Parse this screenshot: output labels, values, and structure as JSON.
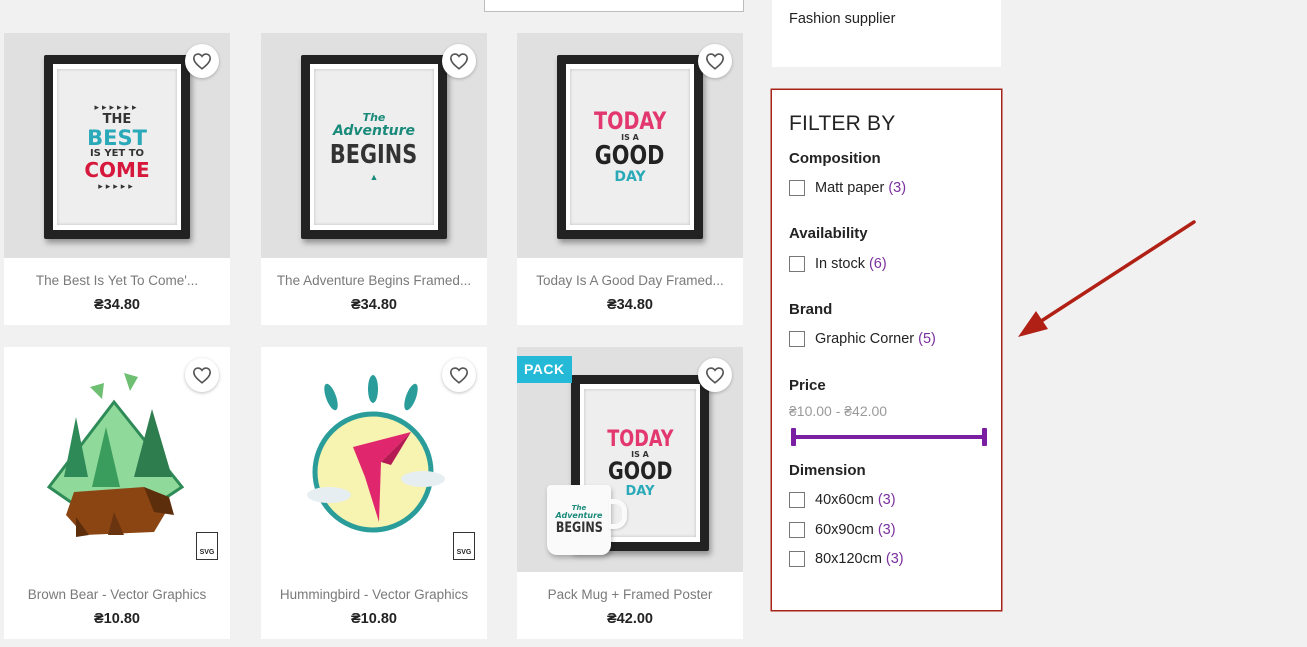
{
  "products": [
    {
      "name": "The Best Is Yet To Come'...",
      "price": "₴34.80",
      "poster": [
        "THE",
        "BEST",
        "IS YET TO",
        "COME"
      ]
    },
    {
      "name": "The Adventure Begins Framed...",
      "price": "₴34.80",
      "poster": [
        "The",
        "Adventure",
        "BEGINS"
      ]
    },
    {
      "name": "Today Is A Good Day Framed...",
      "price": "₴34.80",
      "poster": [
        "TODAY",
        "IS A",
        "GOOD",
        "DAY"
      ]
    },
    {
      "name": "Brown Bear - Vector Graphics",
      "price": "₴10.80",
      "file_badge": "SVG"
    },
    {
      "name": "Hummingbird - Vector Graphics",
      "price": "₴10.80",
      "file_badge": "SVG"
    },
    {
      "name": "Pack Mug + Framed Poster",
      "price": "₴42.00",
      "badge": "PACK",
      "poster": [
        "TODAY",
        "IS A",
        "GOOD",
        "DAY"
      ],
      "mug": [
        "The",
        "Adventure",
        "BEGINS"
      ]
    }
  ],
  "supplier": {
    "label": "Fashion supplier"
  },
  "filter": {
    "title": "FILTER BY",
    "composition": {
      "title": "Composition",
      "options": [
        {
          "label": "Matt paper",
          "count": "(3)"
        }
      ]
    },
    "availability": {
      "title": "Availability",
      "options": [
        {
          "label": "In stock",
          "count": "(6)"
        }
      ]
    },
    "brand": {
      "title": "Brand",
      "options": [
        {
          "label": "Graphic Corner",
          "count": "(5)"
        }
      ]
    },
    "price": {
      "title": "Price",
      "range": "₴10.00 - ₴42.00",
      "min_fraction": 0,
      "max_fraction": 1
    },
    "dimension": {
      "title": "Dimension",
      "options": [
        {
          "label": "40x60cm",
          "count": "(3)"
        },
        {
          "label": "60x90cm",
          "count": "(3)"
        },
        {
          "label": "80x120cm",
          "count": "(3)"
        }
      ]
    }
  },
  "colors": {
    "accent": "#7a1fa2",
    "highlight_border": "#a82318",
    "pack_badge": "#24b9d7",
    "arrow": "#b02015"
  },
  "icons": {
    "wishlist": "heart-outline-icon",
    "annotation": "red-arrow-icon"
  }
}
